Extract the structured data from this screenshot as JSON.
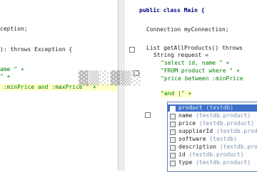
{
  "left_code": [
    "ception;",
    "): throws Exception {",
    "ame \" +",
    "\" +",
    " :minPrice and :maxPrice \" +"
  ],
  "right_code": [
    "public class Main {",
    "Connection myConnection;",
    "List getAllProducts() throws",
    "String request =",
    "\"select id, name \" +",
    "\"FROM product where \" +",
    "\"price between :minPrice",
    "\"and |\" +"
  ],
  "completion": {
    "items": [
      {
        "name": "product",
        "hint": "(testdb)"
      },
      {
        "name": "name",
        "hint": "(testdb.product)"
      },
      {
        "name": "price",
        "hint": "(testdb.product)"
      },
      {
        "name": "supplierId",
        "hint": "(testdb.product)"
      },
      {
        "name": "software",
        "hint": "(testdb)"
      },
      {
        "name": "description",
        "hint": "(testdb.product)"
      },
      {
        "name": "id",
        "hint": "(testdb.product)"
      },
      {
        "name": "type",
        "hint": "(testdb.product)"
      }
    ],
    "selected_index": 0
  }
}
